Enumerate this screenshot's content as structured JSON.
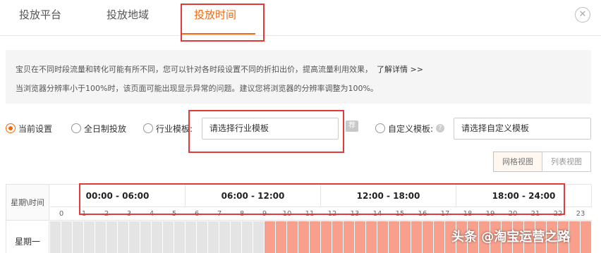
{
  "tabs": [
    {
      "label": "投放平台"
    },
    {
      "label": "投放地域"
    },
    {
      "label": "投放时间"
    }
  ],
  "close_icon": "close-icon",
  "notice": {
    "line1": "宝贝在不同时段流量和转化可能有所不同，您可以针对各时段设置不同的折扣出价，提高流量利用效果，",
    "link": "了解详情 >>",
    "line2": "当浏览器分辨率小于100%时，该页面可能出现显示异常的问题。建议您将浏览器的分辨率调整为100%。"
  },
  "options": {
    "current": "当前设置",
    "all_day": "全日制投放",
    "industry": "行业模板:",
    "industry_placeholder": "请选择行业模板",
    "recommend": "荐",
    "custom": "自定义模板:",
    "custom_placeholder": "请选择自定义模板",
    "help": "?"
  },
  "views": {
    "grid": "网格视图",
    "list": "列表视图"
  },
  "schedule": {
    "corner": "星期\\时间",
    "ranges": [
      "00:00 - 06:00",
      "06:00 - 12:00",
      "12:00 - 18:00",
      "18:00 - 24:00"
    ],
    "hours": [
      "0",
      "1",
      "2",
      "3",
      "4",
      "5",
      "6",
      "7",
      "8",
      "9",
      "10",
      "11",
      "12",
      "13",
      "14",
      "15",
      "16",
      "17",
      "18",
      "19",
      "20",
      "21",
      "22",
      "23"
    ],
    "rows": [
      {
        "label": "星期一",
        "active_from_halfhour": 19
      }
    ]
  },
  "colors": {
    "accent": "#f4670f",
    "active_cell": "#f9a08c",
    "inactive_cell": "#e4e4e4",
    "highlight_box": "#e03a3a"
  },
  "watermark": "头条 @淘宝运营之路"
}
